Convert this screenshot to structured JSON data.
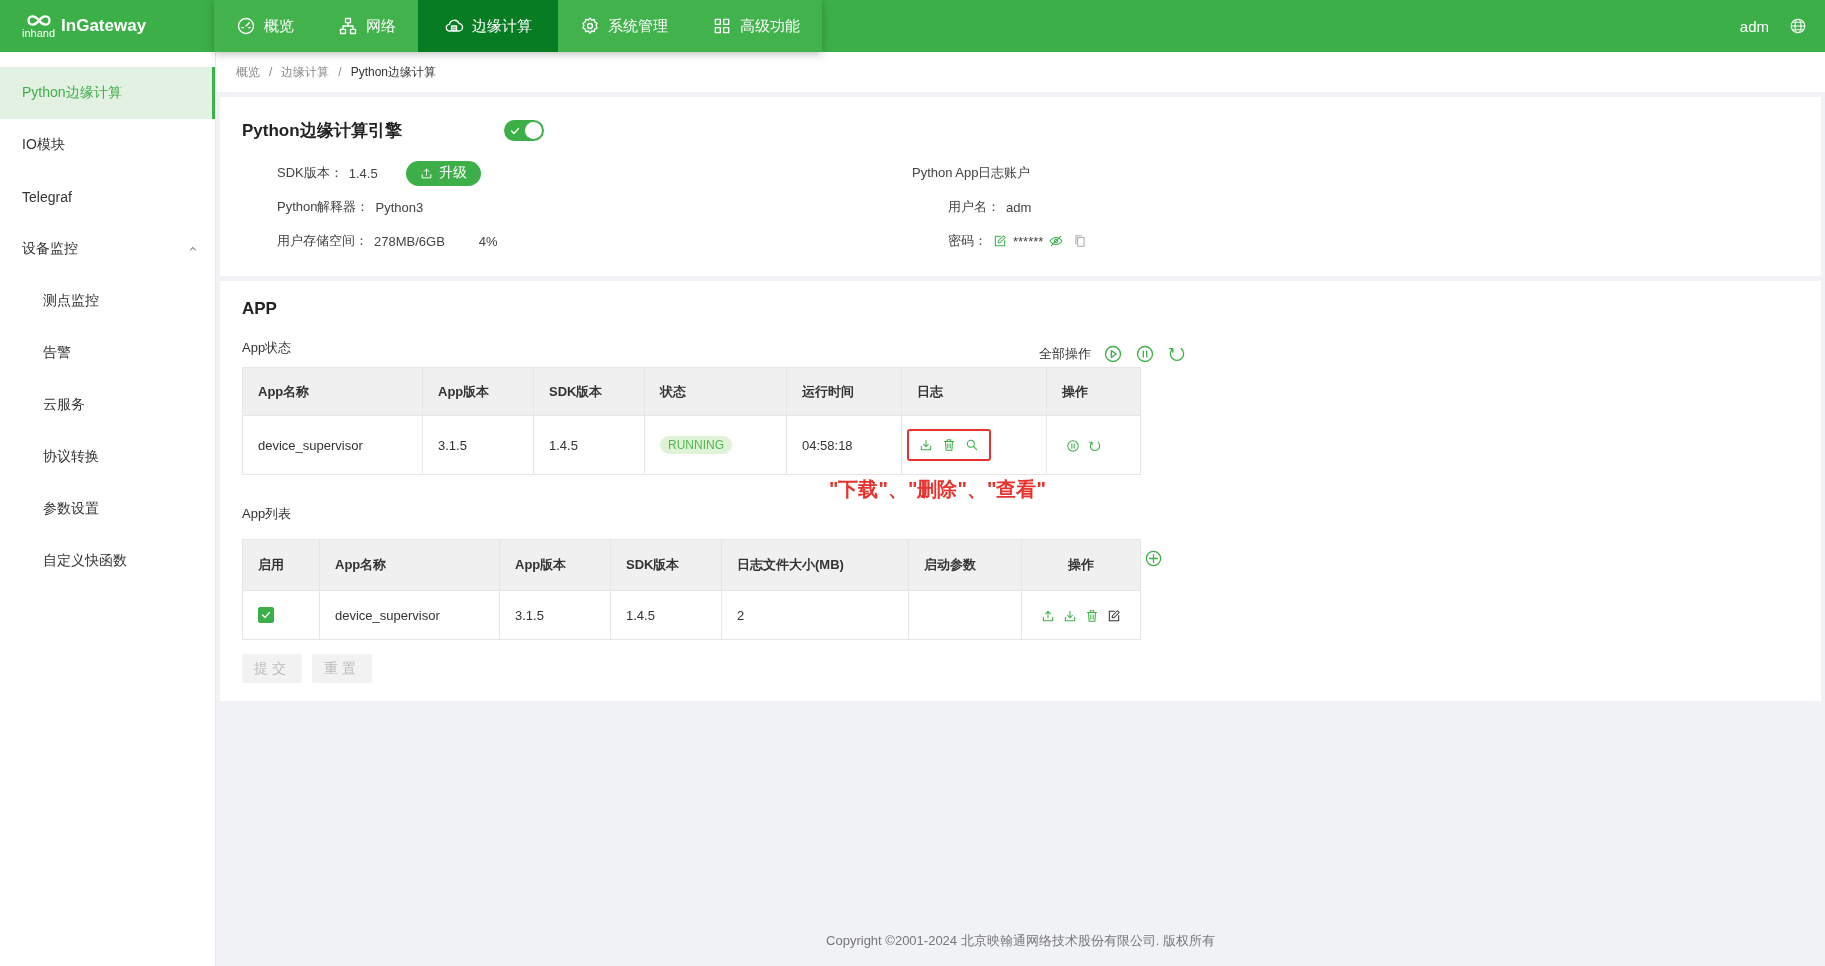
{
  "header": {
    "logo_small": "inhand",
    "logo": "InGateway",
    "nav": [
      {
        "label": "概览",
        "kind": "gauge",
        "selected": false
      },
      {
        "label": "网络",
        "kind": "network",
        "selected": false
      },
      {
        "label": "边缘计算",
        "kind": "cloud",
        "selected": true
      },
      {
        "label": "系统管理",
        "kind": "gear",
        "selected": false
      },
      {
        "label": "高级功能",
        "kind": "grid",
        "selected": false
      }
    ],
    "user": "adm"
  },
  "sidebar": {
    "items": [
      {
        "label": "Python边缘计算",
        "selected": true
      },
      {
        "label": "IO模块",
        "selected": false
      },
      {
        "label": "Telegraf",
        "selected": false
      },
      {
        "label": "设备监控",
        "selected": false,
        "expanded": true,
        "children": [
          {
            "label": "测点监控",
            "selected": false
          },
          {
            "label": "告警",
            "selected": false
          },
          {
            "label": "云服务",
            "selected": false
          },
          {
            "label": "协议转换",
            "selected": false
          },
          {
            "label": "参数设置",
            "selected": false
          },
          {
            "label": "自定义快函数",
            "selected": false
          }
        ]
      }
    ]
  },
  "breadcrumb": [
    {
      "kind": "link",
      "text": "概览"
    },
    {
      "kind": "separator",
      "text": "/"
    },
    {
      "kind": "link",
      "text": "边缘计算"
    },
    {
      "kind": "separator",
      "text": "/"
    },
    {
      "kind": "current",
      "text": "Python边缘计算"
    }
  ],
  "engine": {
    "title": "Python边缘计算引擎",
    "enabled": true,
    "sdk_label": "SDK版本：",
    "sdk_value": "1.4.5",
    "upgrade_button": "升级",
    "interpreter_label": "Python解释器：",
    "interpreter_value": "Python3",
    "storage_label": "用户存储空间：",
    "storage_value": "278MB/6GB",
    "storage_percent": "4%",
    "log_account": {
      "title": "Python App日志账户",
      "username_label": "用户名：",
      "username": "adm",
      "password_label": "密码：",
      "password": "******"
    }
  },
  "app": {
    "title": "APP",
    "status_title": "App状态",
    "all_actions_label": "全部操作",
    "status_table": {
      "columns": [
        "App名称",
        "App版本",
        "SDK版本",
        "状态",
        "运行时间",
        "日志",
        "操作"
      ],
      "rows": [
        {
          "name": "device_supervisor",
          "app_version": "3.1.5",
          "sdk_version": "1.4.5",
          "status": "RUNNING",
          "uptime": "04:58:18"
        }
      ]
    },
    "annotation": "\"下载\"、\"删除\"、\"查看\"",
    "list_title": "App列表",
    "list_table": {
      "columns": [
        "启用",
        "App名称",
        "App版本",
        "SDK版本",
        "日志文件大小(MB)",
        "启动参数",
        "操作"
      ],
      "rows": [
        {
          "enabled": true,
          "name": "device_supervisor",
          "app_version": "3.1.5",
          "sdk_version": "1.4.5",
          "log_size": "2"
        }
      ]
    },
    "buttons": [
      {
        "label": "提交",
        "disabled": true
      },
      {
        "label": "重置",
        "disabled": true
      }
    ]
  },
  "footer": "Copyright ©2001-2024 北京映翰通网络技术股份有限公司. 版权所有"
}
